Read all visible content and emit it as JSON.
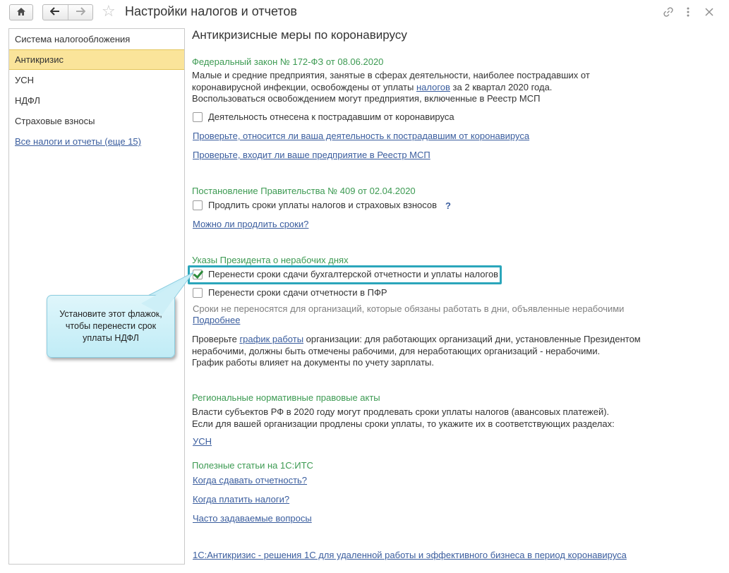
{
  "window": {
    "title": "Настройки налогов и отчетов",
    "home_icon": "home-icon",
    "back_icon": "arrow-left-icon",
    "forward_icon": "arrow-right-icon",
    "favorite_icon": "star-icon",
    "link_icon": "link-icon",
    "more_icon": "more-vertical-icon",
    "close_icon": "close-icon"
  },
  "sidebar": {
    "items": [
      {
        "label": "Система налогообложения"
      },
      {
        "label": "Антикризис",
        "active": true
      },
      {
        "label": "УСН"
      },
      {
        "label": "НДФЛ"
      },
      {
        "label": "Страховые взносы"
      }
    ],
    "all_link": "Все налоги и отчеты (еще 15)"
  },
  "main": {
    "page_title": "Антикризисные меры по коронавирусу",
    "federal_law": {
      "heading": "Федеральный закон № 172-ФЗ от 08.06.2020",
      "text_line1": "Малые и средние предприятия, занятые в сферах деятельности, наиболее пострадавших от",
      "text_line2_before": "коронавирусной инфекции, освобождены от уплаты ",
      "text_line2_link": "налогов",
      "text_line2_after": " за 2 квартал 2020 года.",
      "text_line3": "Воспользоваться освобождением могут предприятия, включенные в Реестр МСП",
      "checkbox_label": "Деятельность отнесена к пострадавшим от коронавируса",
      "checkbox_checked": false,
      "link1": "Проверьте, относится ли ваша деятельность к пострадавшим от коронавируса",
      "link2": "Проверьте, входит ли ваше предприятие в Реестр МСП"
    },
    "resolution": {
      "heading": "Постановление Правительства № 409 от 02.04.2020",
      "checkbox_label": "Продлить сроки уплаты налогов и страховых взносов",
      "checkbox_checked": false,
      "help": "?",
      "link": "Можно ли продлить сроки?"
    },
    "decrees": {
      "heading": "Указы Президента о нерабочих днях",
      "checkbox1_label": "Перенести сроки сдачи бухгалтерской отчетности и уплаты налогов",
      "checkbox1_checked": true,
      "checkbox2_label": "Перенести сроки сдачи отчетности в ПФР",
      "checkbox2_checked": false,
      "note": "Сроки не переносятся для организаций, которые обязаны работать в дни, объявленные нерабочими",
      "more_link": "Подробнее",
      "check_before": "Проверьте ",
      "check_link": "график работы",
      "check_after": " организации: для работающих организаций дни, установленные Президентом",
      "check_line2": "нерабочими, должны быть отмечены рабочими, для неработающих организаций - нерабочими.",
      "check_line3": "График работы влияет на документы по учету зарплаты."
    },
    "regional": {
      "heading": "Региональные нормативные правовые акты",
      "text_line1": "Власти субъектов РФ в 2020 году могут продлевать сроки уплаты налогов (авансовых платежей).",
      "text_line2": "Если для вашей организации продлены сроки уплаты, то укажите их в соответствующих разделах:",
      "link": "УСН"
    },
    "articles": {
      "heading": "Полезные статьи на 1С:ИТС",
      "links": [
        "Когда сдавать отчетность?",
        "Когда платить налоги?",
        "Часто задаваемые вопросы"
      ]
    },
    "footer_link": "1С:Антикризис - решения 1С для удаленной работы и эффективного бизнеса в период коронавируса"
  },
  "callout": {
    "text": "Установите этот флажок, чтобы перенести срок уплаты НДФЛ"
  },
  "colors": {
    "accent_green": "#3c9a52",
    "link_blue": "#3a5d9e",
    "active_item": "#fae49a",
    "highlight_border": "#2ba6bb"
  }
}
